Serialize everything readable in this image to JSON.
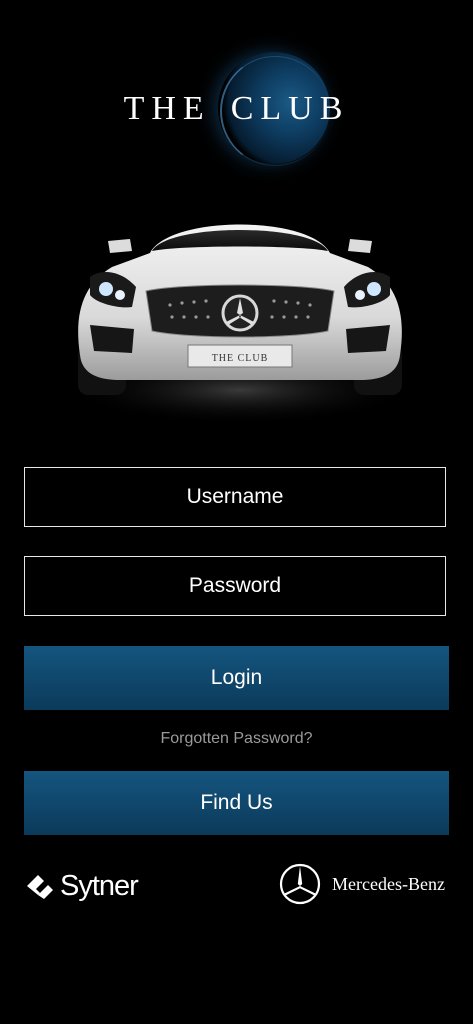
{
  "app": {
    "logo_text_left": "THE",
    "logo_text_right": "CLUB",
    "plate_text": "THE CLUB"
  },
  "form": {
    "username_placeholder": "Username",
    "password_placeholder": "Password",
    "login_label": "Login",
    "forgot_label": "Forgotten Password?",
    "find_us_label": "Find Us"
  },
  "footer": {
    "sytner_label": "Sytner",
    "mercedes_label": "Mercedes-Benz"
  },
  "icons": {
    "sytner_logo": "sytner-diamond-icon",
    "mercedes_logo": "mercedes-star-icon"
  },
  "colors": {
    "background": "#000000",
    "button": "#0f4a72",
    "forgot_text": "#9a9a9a",
    "logo_glow": "#1a5a86"
  }
}
